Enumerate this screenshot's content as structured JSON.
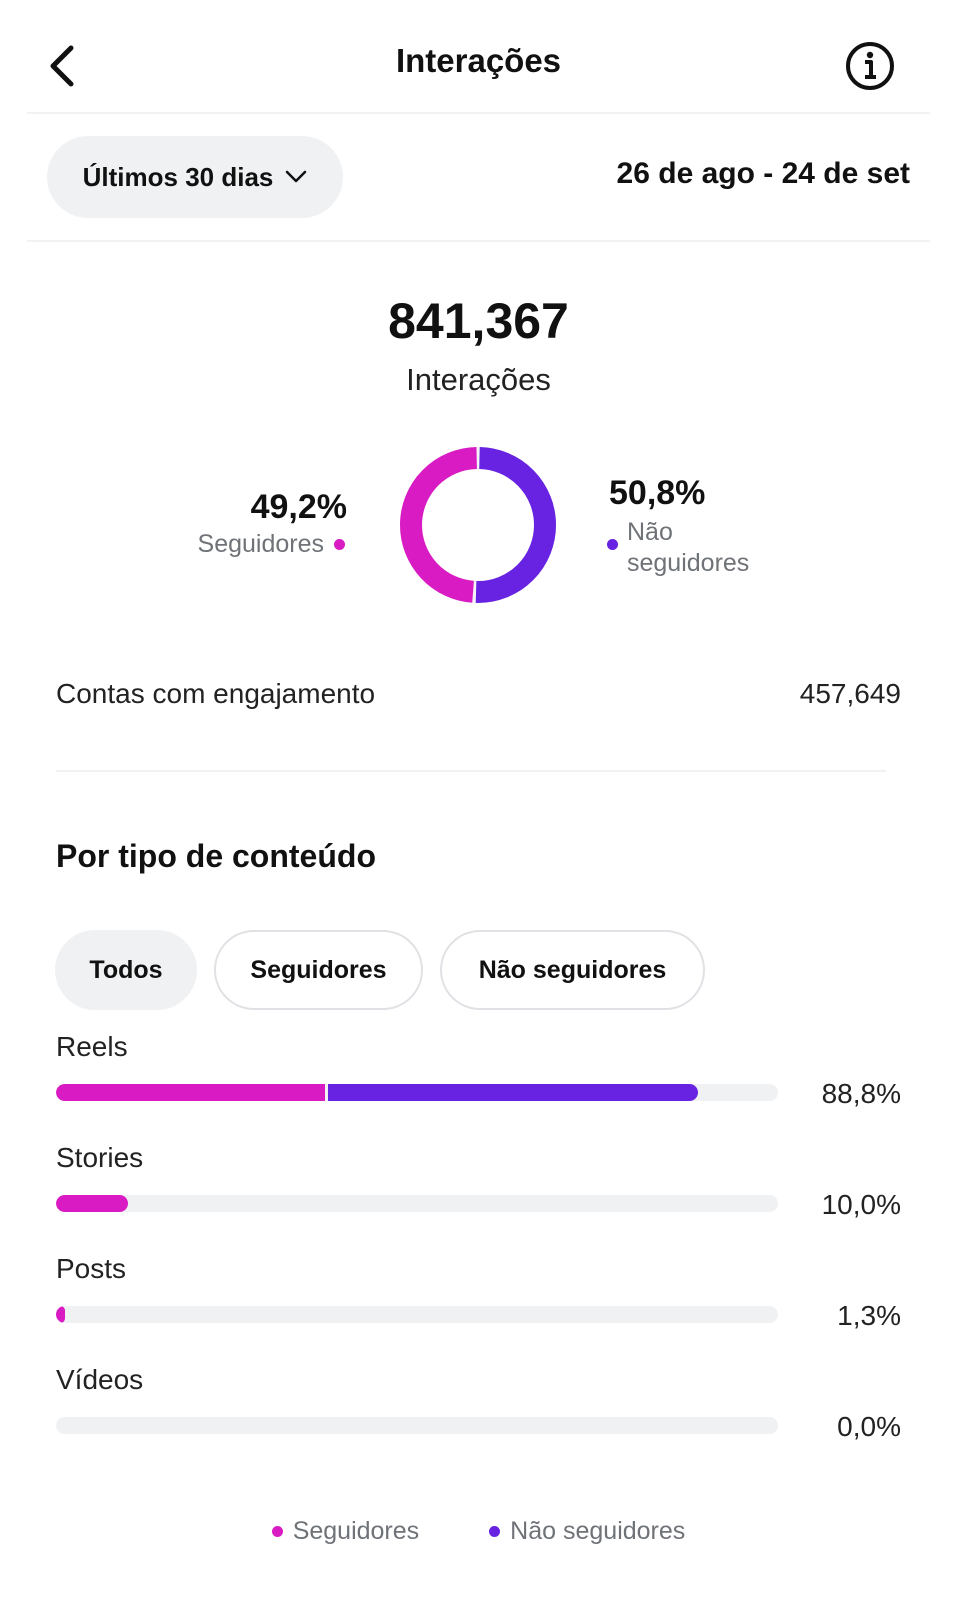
{
  "header": {
    "title": "Interações"
  },
  "filter": {
    "period_label": "Últimos 30 dias",
    "date_range": "26 de ago - 24 de set"
  },
  "summary": {
    "total_value": "841,367",
    "total_label": "Interações",
    "followers_pct": "49,2%",
    "followers_label": "Seguidores",
    "nonfollowers_pct": "50,8%",
    "nonfollowers_label": "Não seguidores",
    "engaged_accounts_label": "Contas com engajamento",
    "engaged_accounts_value": "457,649"
  },
  "colors": {
    "followers": "#d91bc4",
    "nonfollowers": "#6722e2",
    "track": "#eff1f3"
  },
  "content_type": {
    "title": "Por tipo de conteúdo",
    "chips": [
      "Todos",
      "Seguidores",
      "Não seguidores"
    ],
    "selected_chip": "Todos",
    "rows": [
      {
        "label": "Reels",
        "pct": "88,8%",
        "followers_fraction": 0.372,
        "nonfollowers_fraction": 0.516
      },
      {
        "label": "Stories",
        "pct": "10,0%",
        "followers_fraction": 0.1,
        "nonfollowers_fraction": 0.0
      },
      {
        "label": "Posts",
        "pct": "1,3%",
        "followers_fraction": 0.013,
        "nonfollowers_fraction": 0.0
      },
      {
        "label": "Vídeos",
        "pct": "0,0%",
        "followers_fraction": 0.0,
        "nonfollowers_fraction": 0.0
      }
    ],
    "legend": [
      "Seguidores",
      "Não seguidores"
    ]
  },
  "chart_data": {
    "type": "pie",
    "categories": [
      "Seguidores",
      "Não seguidores"
    ],
    "values": [
      49.2,
      50.8
    ]
  }
}
